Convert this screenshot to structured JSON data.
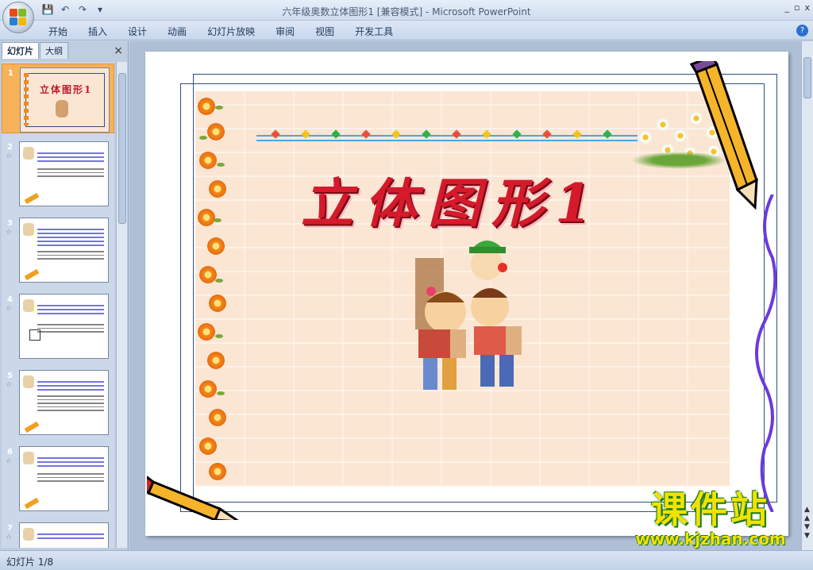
{
  "window": {
    "title": "六年级奥数立体图形1 [兼容模式] - Microsoft PowerPoint",
    "controls": [
      "_",
      "▫",
      "x"
    ]
  },
  "qat": {
    "save": "save-icon",
    "undo": "undo-icon",
    "redo": "redo-icon",
    "more": "▾"
  },
  "ribbon": {
    "tabs": [
      "开始",
      "插入",
      "设计",
      "动画",
      "幻灯片放映",
      "审阅",
      "视图",
      "开发工具"
    ],
    "help": "?"
  },
  "panel": {
    "tabs": [
      "幻灯片",
      "大纲"
    ],
    "close": "×",
    "slides": [
      {
        "num": "1",
        "selected": true
      },
      {
        "num": "2",
        "selected": false
      },
      {
        "num": "3",
        "selected": false
      },
      {
        "num": "4",
        "selected": false
      },
      {
        "num": "5",
        "selected": false
      },
      {
        "num": "6",
        "selected": false
      },
      {
        "num": "7",
        "selected": false
      }
    ]
  },
  "slide": {
    "title": "立体图形1"
  },
  "watermark": {
    "main": "课件站",
    "url": "www.kjzhan.com"
  },
  "status": {
    "slide_counter": "幻灯片 1/8"
  },
  "colors": {
    "title_red": "#d41a2b",
    "selected_thumb": "#f7b25a",
    "watermark_yellow": "#f2e200"
  }
}
